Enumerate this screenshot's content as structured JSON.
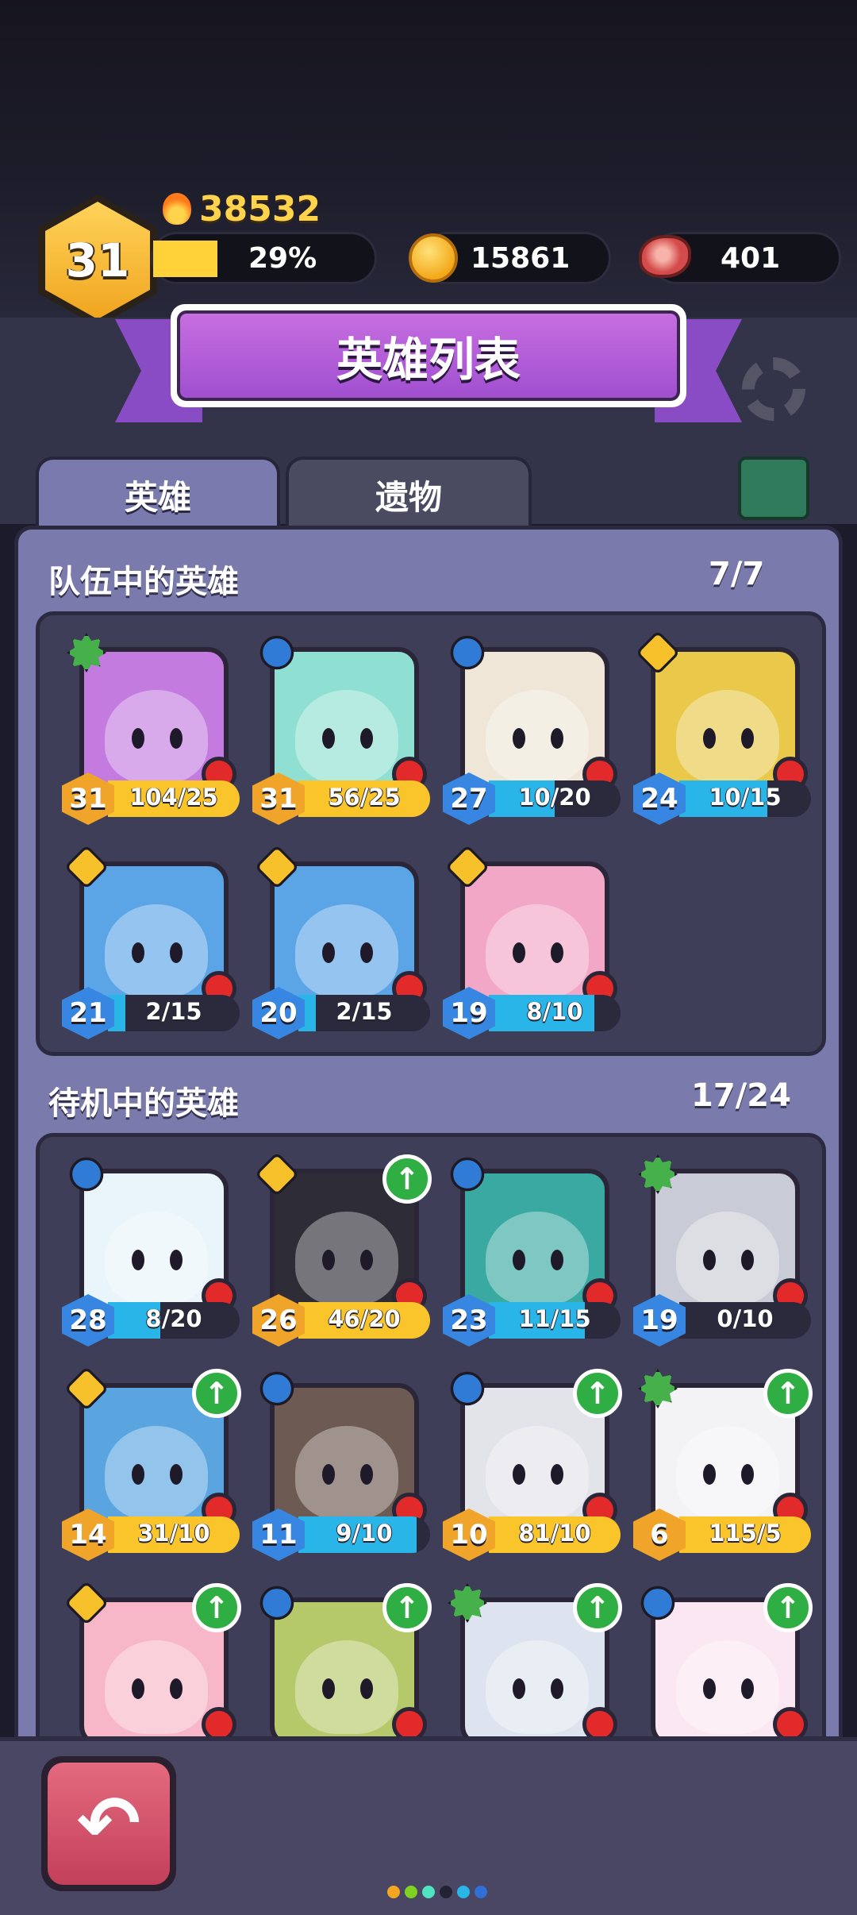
{
  "player": {
    "level": "31",
    "power": "38532",
    "xp_percent_label": "29%",
    "xp_fraction": 0.29,
    "gold": "15861",
    "meat": "401"
  },
  "title": "英雄列表",
  "tabs": [
    {
      "label": "英雄",
      "active": true
    },
    {
      "label": "遗物",
      "active": false
    }
  ],
  "team": {
    "title": "队伍中的英雄",
    "count": "7/7",
    "heroes": [
      {
        "name_icon": "hero-purple-armor",
        "class": "virus",
        "level": "31",
        "progress": "104/25",
        "fill": 1.0,
        "bar": "gold",
        "badge": "gold",
        "upgrade": false,
        "color": "#c47be0"
      },
      {
        "name_icon": "hero-bunny",
        "class": "bug",
        "level": "31",
        "progress": "56/25",
        "fill": 1.0,
        "bar": "gold",
        "badge": "gold",
        "upgrade": false,
        "color": "#8fe0d2"
      },
      {
        "name_icon": "hero-mummy",
        "class": "bug",
        "level": "27",
        "progress": "10/20",
        "fill": 0.5,
        "bar": "blue",
        "badge": "blue",
        "upgrade": false,
        "color": "#efe6d8"
      },
      {
        "name_icon": "hero-ninja",
        "class": "skull",
        "level": "24",
        "progress": "10/15",
        "fill": 0.67,
        "bar": "blue",
        "badge": "blue",
        "upgrade": false,
        "color": "#e9c84a"
      },
      {
        "name_icon": "hero-pirate",
        "class": "skull",
        "level": "21",
        "progress": "2/15",
        "fill": 0.13,
        "bar": "blue",
        "badge": "blue",
        "upgrade": false,
        "color": "#5ba5e6"
      },
      {
        "name_icon": "hero-knight",
        "class": "skull",
        "level": "20",
        "progress": "2/15",
        "fill": 0.13,
        "bar": "blue",
        "badge": "blue",
        "upgrade": false,
        "color": "#5ba5e6"
      },
      {
        "name_icon": "hero-pink-crown",
        "class": "skull",
        "level": "19",
        "progress": "8/10",
        "fill": 0.8,
        "bar": "blue",
        "badge": "blue",
        "upgrade": false,
        "color": "#f3a7c6"
      }
    ]
  },
  "reserve": {
    "title": "待机中的英雄",
    "count": "17/24",
    "heroes": [
      {
        "name_icon": "hero-snowman",
        "class": "bug",
        "level": "28",
        "progress": "8/20",
        "fill": 0.4,
        "bar": "blue",
        "badge": "blue",
        "upgrade": false,
        "color": "#e9f4fb"
      },
      {
        "name_icon": "hero-cat",
        "class": "skull",
        "level": "26",
        "progress": "46/20",
        "fill": 1.0,
        "bar": "gold",
        "badge": "gold",
        "upgrade": true,
        "color": "#2e2c36"
      },
      {
        "name_icon": "hero-shark",
        "class": "bug",
        "level": "23",
        "progress": "11/15",
        "fill": 0.73,
        "bar": "blue",
        "badge": "blue",
        "upgrade": false,
        "color": "#3aa9a1"
      },
      {
        "name_icon": "hero-robot-cat",
        "class": "virus",
        "level": "19",
        "progress": "0/10",
        "fill": 0.0,
        "bar": "blue",
        "badge": "blue",
        "upgrade": false,
        "color": "#c9ccd6"
      },
      {
        "name_icon": "hero-red-helmet",
        "class": "skull",
        "level": "14",
        "progress": "31/10",
        "fill": 1.0,
        "bar": "gold",
        "badge": "gold",
        "upgrade": true,
        "color": "#5aa5e0"
      },
      {
        "name_icon": "hero-tree",
        "class": "bug",
        "level": "11",
        "progress": "9/10",
        "fill": 0.9,
        "bar": "blue",
        "badge": "blue",
        "upgrade": false,
        "color": "#6d5a52"
      },
      {
        "name_icon": "hero-visor",
        "class": "bug",
        "level": "10",
        "progress": "81/10",
        "fill": 1.0,
        "bar": "gold",
        "badge": "gold",
        "upgrade": true,
        "color": "#e3e3ea"
      },
      {
        "name_icon": "hero-astronaut",
        "class": "virus",
        "level": "6",
        "progress": "115/5",
        "fill": 1.0,
        "bar": "gold",
        "badge": "gold",
        "upgrade": true,
        "color": "#f3f3f6"
      },
      {
        "name_icon": "hero-bow-girl",
        "class": "skull",
        "level": "",
        "progress": "",
        "fill": 0,
        "bar": "gold",
        "badge": "gold",
        "upgrade": true,
        "color": "#f7b7c8"
      },
      {
        "name_icon": "hero-leaf",
        "class": "bug",
        "level": "",
        "progress": "",
        "fill": 0,
        "bar": "gold",
        "badge": "gold",
        "upgrade": true,
        "color": "#b5c96a"
      },
      {
        "name_icon": "hero-aviator",
        "class": "virus",
        "level": "",
        "progress": "",
        "fill": 0,
        "bar": "gold",
        "badge": "gold",
        "upgrade": true,
        "color": "#dde3ef"
      },
      {
        "name_icon": "hero-bunny-pink",
        "class": "bug",
        "level": "",
        "progress": "",
        "fill": 0,
        "bar": "gold",
        "badge": "gold",
        "upgrade": true,
        "color": "#fbe7f1"
      }
    ]
  },
  "upgrade_glyph": "↑",
  "back_glyph": "↶",
  "page_dots": [
    "#f5a623",
    "#7ed321",
    "#50e3c2",
    "#222233",
    "#29b5e8",
    "#2f6fd6"
  ]
}
